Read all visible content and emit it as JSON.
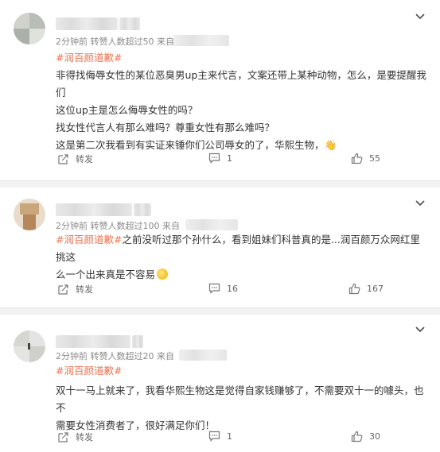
{
  "comments": [
    {
      "meta": "2分钟前  转赞人数超过50  来自",
      "tag": "#润百颜道歉#",
      "lines": [
        "非得找侮辱女性的某位恶臭男up主来代言，文案还带上某种动物，怎么，是要提醒我们",
        "这位up主是怎么侮辱女性的吗？",
        "找女性代言人有那么难吗？尊重女性有那么难吗？",
        "这是第二次我看到有实证来锤你们公司辱女的了，华熙生物，👋"
      ],
      "forward_label": "转发",
      "comment_count": "1",
      "like_count": "55"
    },
    {
      "meta": "2分钟前  转赞人数超过100  来自",
      "tag": "#润百颜道歉#",
      "line1_rest": "之前没听过那个孙什么，看到姐妹们科普真的是...润百颜万众网红里挑这",
      "line2": "么一个出来真是不容易",
      "forward_label": "转发",
      "comment_count": "16",
      "like_count": "167"
    },
    {
      "meta": "2分钟前  转赞人数超过20  来自",
      "tag": "#润百颜道歉#",
      "lines": [
        "双十一马上就来了，我看华熙生物这是觉得自家钱赚够了，不需要双十一的噱头，也不",
        "需要女性消费者了，很好满足你们！"
      ],
      "forward_label": "转发",
      "comment_count": "1",
      "like_count": "30"
    }
  ],
  "colors": {
    "tag": "#eb7350",
    "meta": "#8a8a8a",
    "text": "#333333"
  },
  "icons": [
    "chevron-down-icon",
    "share-icon",
    "comment-icon",
    "like-icon"
  ]
}
